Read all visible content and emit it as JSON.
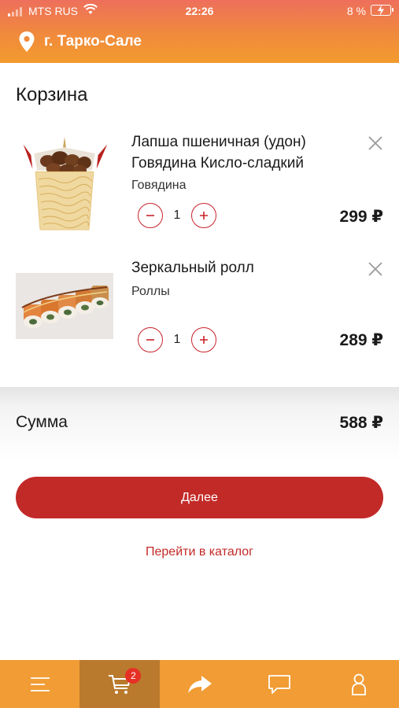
{
  "status_bar": {
    "carrier": "MTS RUS",
    "time": "22:26",
    "battery_percent": "8 %"
  },
  "header": {
    "city": "г. Тарко-Сале",
    "icon": "location-pin-icon"
  },
  "cart": {
    "title": "Корзина",
    "items": [
      {
        "name_line1": "Лапша пшеничная (удон)",
        "name_line2": "Говядина Кисло-сладкий",
        "category": "Говядина",
        "quantity": "1",
        "price": "299 ₽",
        "image": "noodle-box-image"
      },
      {
        "name_line1": "Зеркальный ролл",
        "name_line2": "",
        "category": "Роллы",
        "quantity": "1",
        "price": "289 ₽",
        "image": "sushi-rolls-image"
      }
    ]
  },
  "summary": {
    "label": "Сумма",
    "value": "588 ₽"
  },
  "actions": {
    "next_label": "Далее",
    "catalog_label": "Перейти в каталог"
  },
  "tabbar": {
    "items": [
      "menu-icon",
      "cart-icon",
      "share-icon",
      "chat-icon",
      "profile-icon"
    ],
    "cart_badge": "2",
    "active": "cart-icon"
  },
  "colors": {
    "accent_red": "#c22a28",
    "tabbar": "#f19c34",
    "tabbar_active": "#b97a2d",
    "header_top": "#ee6f5c",
    "header_bottom": "#f39b2e"
  }
}
